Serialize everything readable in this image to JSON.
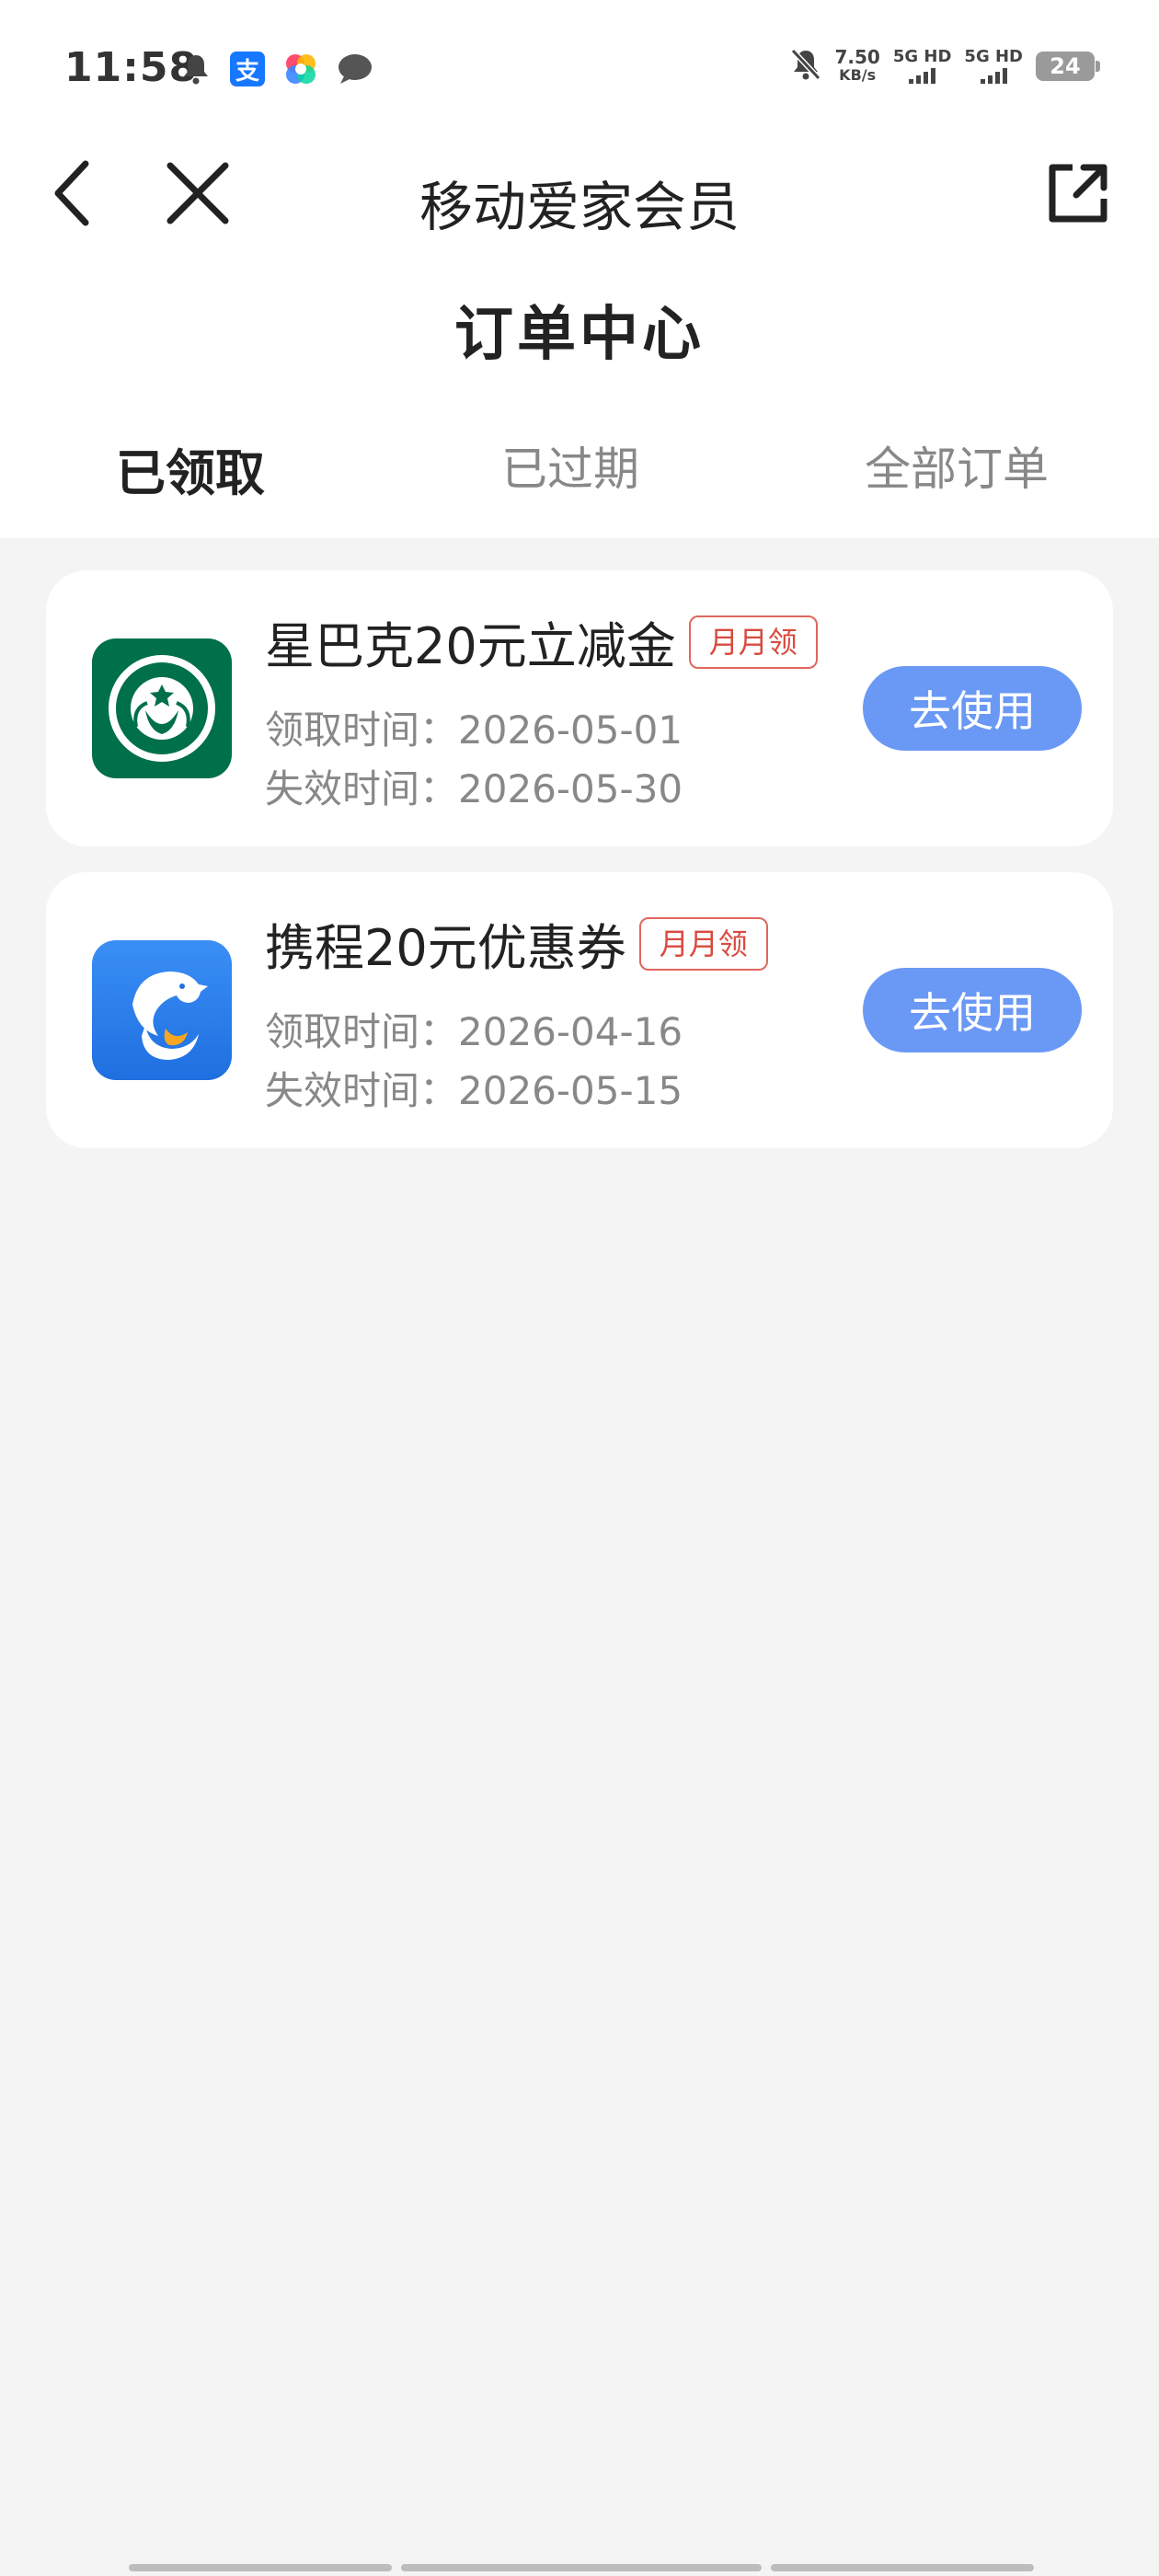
{
  "status_bar": {
    "time": "11:58",
    "alipay_glyph": "支",
    "speed_value": "7.50",
    "speed_unit": "KB/s",
    "sim1": "5G HD",
    "sim2": "5G HD",
    "battery": "24",
    "icons": [
      "bell-icon",
      "alipay-icon",
      "colorful-app-icon",
      "message-icon",
      "mute-bell-icon"
    ]
  },
  "nav": {
    "title": "移动爱家会员",
    "back_icon": "chevron-left-icon",
    "close_icon": "close-icon",
    "share_icon": "share-external-icon"
  },
  "page": {
    "title": "订单中心"
  },
  "tabs": [
    {
      "label": "已领取",
      "active": true
    },
    {
      "label": "已过期",
      "active": false
    },
    {
      "label": "全部订单",
      "active": false
    }
  ],
  "orders": [
    {
      "title": "星巴克20元立减金",
      "badge": "月月领",
      "received": "领取时间：2026-05-01",
      "expires": "失效时间：2026-05-30",
      "button": "去使用",
      "logo": "starbucks-logo",
      "logo_color": "#00704a"
    },
    {
      "title": "携程20元优惠券",
      "badge": "月月领",
      "received": "领取时间：2026-04-16",
      "expires": "失效时间：2026-05-15",
      "button": "去使用",
      "logo": "ctrip-dolphin-logo",
      "logo_color": "#2a7ff0"
    }
  ],
  "colors": {
    "accent_button": "#6a98f5",
    "badge_red": "#d94a3f",
    "tab_underline": [
      "#b388ff",
      "#6a8dff"
    ],
    "background": "#f4f4f4"
  }
}
